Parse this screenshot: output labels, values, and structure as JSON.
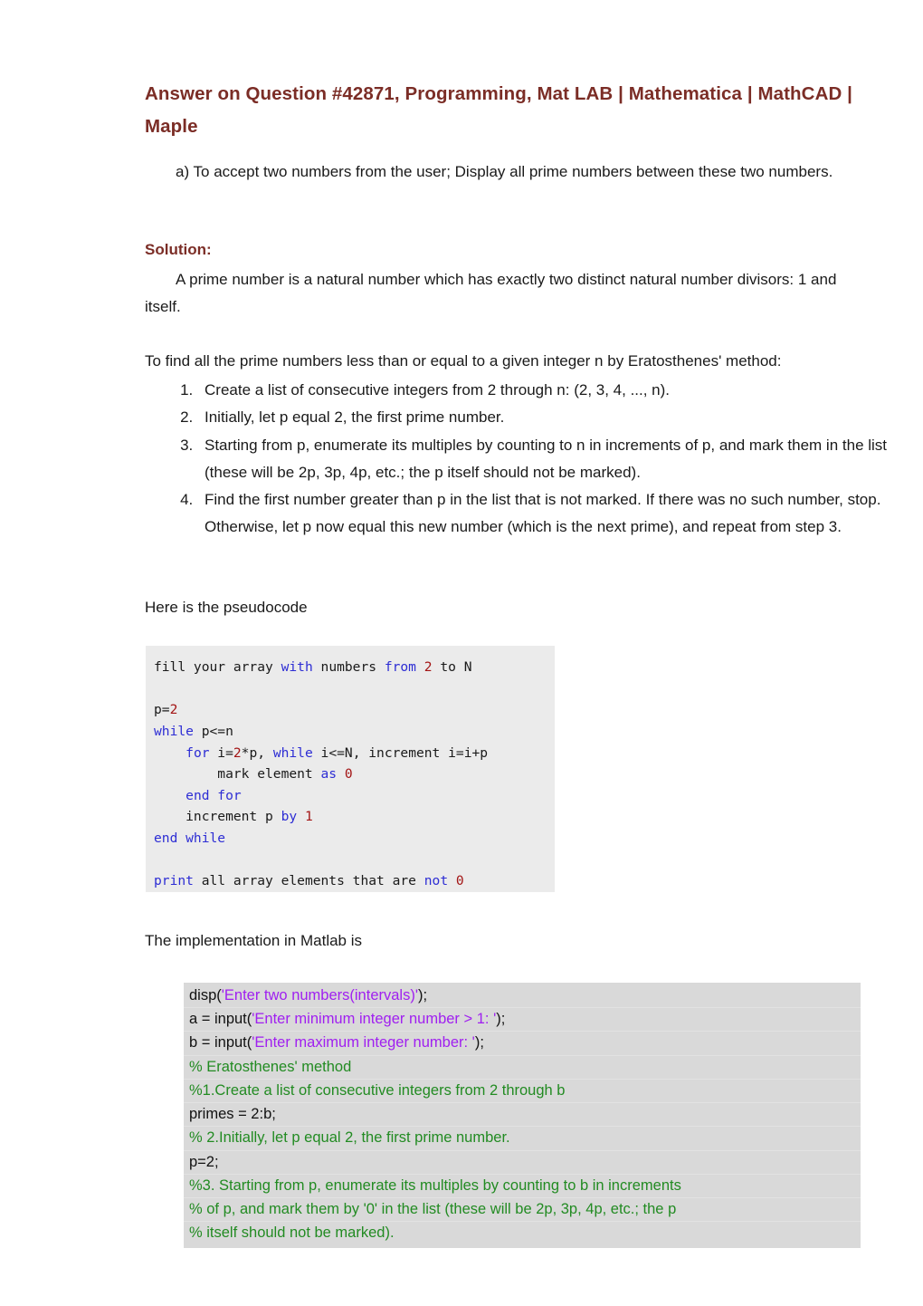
{
  "document": {
    "title": "Answer on Question #42871, Programming, Mat LAB | Mathematica | MathCAD | Maple",
    "title_color": "#7b2d26",
    "question": "a) To accept two numbers from the user; Display all prime numbers between these two numbers.",
    "solution_heading": "Solution:",
    "definition": "A prime number is a natural number which has exactly two distinct natural number divisors: 1 and itself.",
    "method_intro": "To find all the prime numbers less than or equal to a given integer n by Eratosthenes' method:",
    "steps": [
      "Create a list of consecutive integers from 2 through n: (2, 3, 4, ..., n).",
      "Initially, let p equal 2, the first prime number.",
      "Starting from p, enumerate its multiples by counting to n in increments of p, and mark them in the list (these will be 2p, 3p, 4p, etc.; the p itself should not be marked).",
      "Find the first number greater than p in the list that is not marked. If there was no such number, stop. Otherwise, let p now equal this new number (which is the next prime), and repeat from step 3."
    ],
    "pseudocode_intro": "Here is the pseudocode",
    "implementation_intro": "The implementation in Matlab is"
  },
  "pseudocode": {
    "background": "#ebebeb",
    "keyword_color": "#2d2dd4",
    "number_color": "#a31515",
    "lines": [
      [
        {
          "t": "fill your array ",
          "c": "plain"
        },
        {
          "t": "with",
          "c": "kw"
        },
        {
          "t": " numbers ",
          "c": "plain"
        },
        {
          "t": "from",
          "c": "kw"
        },
        {
          "t": " ",
          "c": "plain"
        },
        {
          "t": "2",
          "c": "num"
        },
        {
          "t": " to N",
          "c": "plain"
        }
      ],
      [],
      [
        {
          "t": "p=",
          "c": "plain"
        },
        {
          "t": "2",
          "c": "num"
        }
      ],
      [
        {
          "t": "while",
          "c": "kw"
        },
        {
          "t": " p<=n",
          "c": "plain"
        }
      ],
      [
        {
          "t": "    ",
          "c": "plain"
        },
        {
          "t": "for",
          "c": "kw"
        },
        {
          "t": " i=",
          "c": "plain"
        },
        {
          "t": "2",
          "c": "num"
        },
        {
          "t": "*p, ",
          "c": "plain"
        },
        {
          "t": "while",
          "c": "kw"
        },
        {
          "t": " i<=N, increment i=i+p",
          "c": "plain"
        }
      ],
      [
        {
          "t": "        mark element ",
          "c": "plain"
        },
        {
          "t": "as",
          "c": "kw"
        },
        {
          "t": " ",
          "c": "plain"
        },
        {
          "t": "0",
          "c": "num"
        }
      ],
      [
        {
          "t": "    ",
          "c": "plain"
        },
        {
          "t": "end for",
          "c": "kw"
        }
      ],
      [
        {
          "t": "    increment p ",
          "c": "plain"
        },
        {
          "t": "by",
          "c": "kw"
        },
        {
          "t": " ",
          "c": "plain"
        },
        {
          "t": "1",
          "c": "num"
        }
      ],
      [
        {
          "t": "end while",
          "c": "kw"
        }
      ],
      [],
      [
        {
          "t": "print",
          "c": "kw"
        },
        {
          "t": " all array elements that are ",
          "c": "plain"
        },
        {
          "t": "not",
          "c": "kw"
        },
        {
          "t": " ",
          "c": "plain"
        },
        {
          "t": "0",
          "c": "num"
        }
      ]
    ]
  },
  "matlab_code": {
    "background": "#d9d9d9",
    "string_color": "#a020f0",
    "comment_color": "#228b22",
    "lines": [
      [
        {
          "t": "disp(",
          "c": "plain"
        },
        {
          "t": "'Enter two numbers(intervals)'",
          "c": "str"
        },
        {
          "t": ");",
          "c": "plain"
        }
      ],
      [
        {
          "t": "a = input(",
          "c": "plain"
        },
        {
          "t": "'Enter minimum integer number > 1: '",
          "c": "str"
        },
        {
          "t": ");",
          "c": "plain"
        }
      ],
      [
        {
          "t": "b = input(",
          "c": "plain"
        },
        {
          "t": "'Enter maximum integer number: '",
          "c": "str"
        },
        {
          "t": ");",
          "c": "plain"
        }
      ],
      [
        {
          "t": "% Eratosthenes' method",
          "c": "cmt"
        }
      ],
      [
        {
          "t": "%1.Create a list of consecutive integers from 2 through b",
          "c": "cmt"
        }
      ],
      [
        {
          "t": "primes = 2:b;",
          "c": "plain"
        }
      ],
      [
        {
          "t": "% 2.Initially, let p equal 2, the first prime number.",
          "c": "cmt"
        }
      ],
      [
        {
          "t": "p=2;",
          "c": "plain"
        }
      ],
      [
        {
          "t": "%3. Starting from p, enumerate its multiples by counting to b in increments",
          "c": "cmt"
        }
      ],
      [
        {
          "t": "% of p, and mark them by '0' in the list (these will be 2p, 3p, 4p, etc.; the p",
          "c": "cmt"
        }
      ],
      [
        {
          "t": "% itself should not be marked).",
          "c": "cmt"
        }
      ]
    ]
  }
}
